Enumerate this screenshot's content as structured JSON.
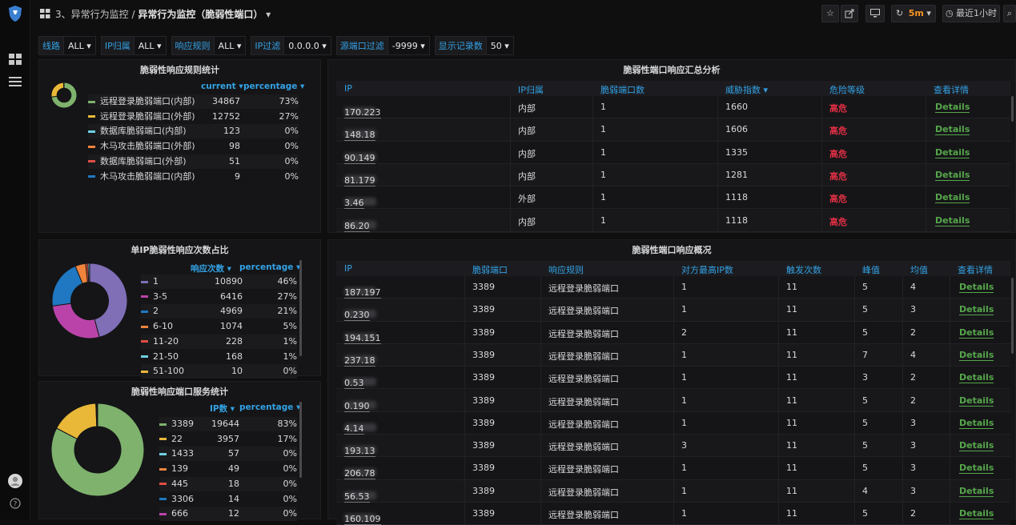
{
  "breadcrumb": {
    "folder": "3、异常行为监控 / ",
    "title": "异常行为监控（脆弱性端口）",
    "caret": "▾"
  },
  "topbar": {
    "refresh": "5m",
    "time_range": "最近1小时"
  },
  "variables": [
    {
      "label": "线路",
      "value": "ALL"
    },
    {
      "label": "IP归属",
      "value": "ALL"
    },
    {
      "label": "响应规则",
      "value": "ALL"
    },
    {
      "label": "IP过滤",
      "value": "0.0.0.0"
    },
    {
      "label": "源端口过滤",
      "value": "-9999"
    },
    {
      "label": "显示记录数",
      "value": "50"
    }
  ],
  "colors": {
    "accent": "#33a2e5",
    "danger": "#e02f44",
    "link": "#56a64b",
    "orange": "#f79520"
  },
  "panel1": {
    "title": "脆弱性响应规则统计",
    "col1": "current ▾",
    "col2": "percentage ▾",
    "rows": [
      {
        "name": "远程登录脆弱端口(内部)",
        "v": "34867",
        "p": "73%",
        "color": "#7eb26d"
      },
      {
        "name": "远程登录脆弱端口(外部)",
        "v": "12752",
        "p": "27%",
        "color": "#eab839"
      },
      {
        "name": "数据库脆弱端口(内部)",
        "v": "123",
        "p": "0%",
        "color": "#6ed0e0"
      },
      {
        "name": "木马攻击脆弱端口(外部)",
        "v": "98",
        "p": "0%",
        "color": "#ef843c"
      },
      {
        "name": "数据库脆弱端口(外部)",
        "v": "51",
        "p": "0%",
        "color": "#e24d42"
      },
      {
        "name": "木马攻击脆弱端口(内部)",
        "v": "9",
        "p": "0%",
        "color": "#1f78c1"
      }
    ]
  },
  "panel2": {
    "title": "单IP脆弱性响应次数占比",
    "col1": "响应次数 ▾",
    "col2": "percentage ▾",
    "rows": [
      {
        "name": "1",
        "v": "10890",
        "p": "46%",
        "color": "#806eb7"
      },
      {
        "name": "3-5",
        "v": "6416",
        "p": "27%",
        "color": "#ba43a9"
      },
      {
        "name": "2",
        "v": "4969",
        "p": "21%",
        "color": "#1f78c1"
      },
      {
        "name": "6-10",
        "v": "1074",
        "p": "5%",
        "color": "#ef843c"
      },
      {
        "name": "11-20",
        "v": "228",
        "p": "1%",
        "color": "#e24d42"
      },
      {
        "name": "21-50",
        "v": "168",
        "p": "1%",
        "color": "#6ed0e0"
      },
      {
        "name": "51-100",
        "v": "10",
        "p": "0%",
        "color": "#eab839"
      }
    ]
  },
  "panel3": {
    "title": "脆弱性响应端口服务统计",
    "col1": "IP数 ▾",
    "col2": "percentage ▾",
    "rows": [
      {
        "name": "3389",
        "v": "19644",
        "p": "83%",
        "color": "#7eb26d"
      },
      {
        "name": "22",
        "v": "3957",
        "p": "17%",
        "color": "#eab839"
      },
      {
        "name": "1433",
        "v": "57",
        "p": "0%",
        "color": "#6ed0e0"
      },
      {
        "name": "139",
        "v": "49",
        "p": "0%",
        "color": "#ef843c"
      },
      {
        "name": "445",
        "v": "18",
        "p": "0%",
        "color": "#e24d42"
      },
      {
        "name": "3306",
        "v": "14",
        "p": "0%",
        "color": "#1f78c1"
      },
      {
        "name": "666",
        "v": "12",
        "p": "0%",
        "color": "#ba43a9"
      }
    ]
  },
  "table1": {
    "title": "脆弱性端口响应汇总分析",
    "headers": [
      "IP",
      "IP归属",
      "脆弱端口数",
      "威胁指数 ▾",
      "危险等级",
      "查看详情"
    ],
    "rows": [
      {
        "ip": "170.223",
        "owner": "内部",
        "ports": "1",
        "score": "1660",
        "level": "高危",
        "link": "Details"
      },
      {
        "ip": "148.18",
        "owner": "内部",
        "ports": "1",
        "score": "1606",
        "level": "高危",
        "link": "Details"
      },
      {
        "ip": "90.149",
        "owner": "内部",
        "ports": "1",
        "score": "1335",
        "level": "高危",
        "link": "Details"
      },
      {
        "ip": "81.179",
        "owner": "内部",
        "ports": "1",
        "score": "1281",
        "level": "高危",
        "link": "Details"
      },
      {
        "ip": "3.46",
        "owner": "外部",
        "ports": "1",
        "score": "1118",
        "level": "高危",
        "link": "Details"
      },
      {
        "ip": "86.20",
        "owner": "内部",
        "ports": "1",
        "score": "1118",
        "level": "高危",
        "link": "Details"
      }
    ]
  },
  "table2": {
    "title": "脆弱性端口响应概况",
    "headers": [
      "IP",
      "脆弱端口",
      "响应规则",
      "对方最高IP数",
      "触发次数",
      "峰值",
      "均值",
      "查看详情"
    ],
    "rows": [
      {
        "ip": "187.197",
        "port": "3389",
        "rule": "远程登录脆弱端口",
        "peer": "1",
        "count": "11",
        "peak": "5",
        "avg": "4",
        "link": "Details"
      },
      {
        "ip": "0.230",
        "port": "3389",
        "rule": "远程登录脆弱端口",
        "peer": "1",
        "count": "11",
        "peak": "5",
        "avg": "3",
        "link": "Details"
      },
      {
        "ip": "194.151",
        "port": "3389",
        "rule": "远程登录脆弱端口",
        "peer": "2",
        "count": "11",
        "peak": "5",
        "avg": "2",
        "link": "Details"
      },
      {
        "ip": "237.18",
        "port": "3389",
        "rule": "远程登录脆弱端口",
        "peer": "1",
        "count": "11",
        "peak": "7",
        "avg": "4",
        "link": "Details"
      },
      {
        "ip": "0.53",
        "port": "3389",
        "rule": "远程登录脆弱端口",
        "peer": "1",
        "count": "11",
        "peak": "3",
        "avg": "2",
        "link": "Details"
      },
      {
        "ip": "0.190",
        "port": "3389",
        "rule": "远程登录脆弱端口",
        "peer": "1",
        "count": "11",
        "peak": "5",
        "avg": "2",
        "link": "Details"
      },
      {
        "ip": "4.14",
        "port": "3389",
        "rule": "远程登录脆弱端口",
        "peer": "1",
        "count": "11",
        "peak": "5",
        "avg": "3",
        "link": "Details"
      },
      {
        "ip": "193.13",
        "port": "3389",
        "rule": "远程登录脆弱端口",
        "peer": "3",
        "count": "11",
        "peak": "5",
        "avg": "3",
        "link": "Details"
      },
      {
        "ip": "206.78",
        "port": "3389",
        "rule": "远程登录脆弱端口",
        "peer": "1",
        "count": "11",
        "peak": "5",
        "avg": "3",
        "link": "Details"
      },
      {
        "ip": "56.53",
        "port": "3389",
        "rule": "远程登录脆弱端口",
        "peer": "1",
        "count": "11",
        "peak": "4",
        "avg": "3",
        "link": "Details"
      },
      {
        "ip": "160.109",
        "port": "3389",
        "rule": "远程登录脆弱端口",
        "peer": "1",
        "count": "11",
        "peak": "5",
        "avg": "2",
        "link": "Details"
      }
    ]
  }
}
